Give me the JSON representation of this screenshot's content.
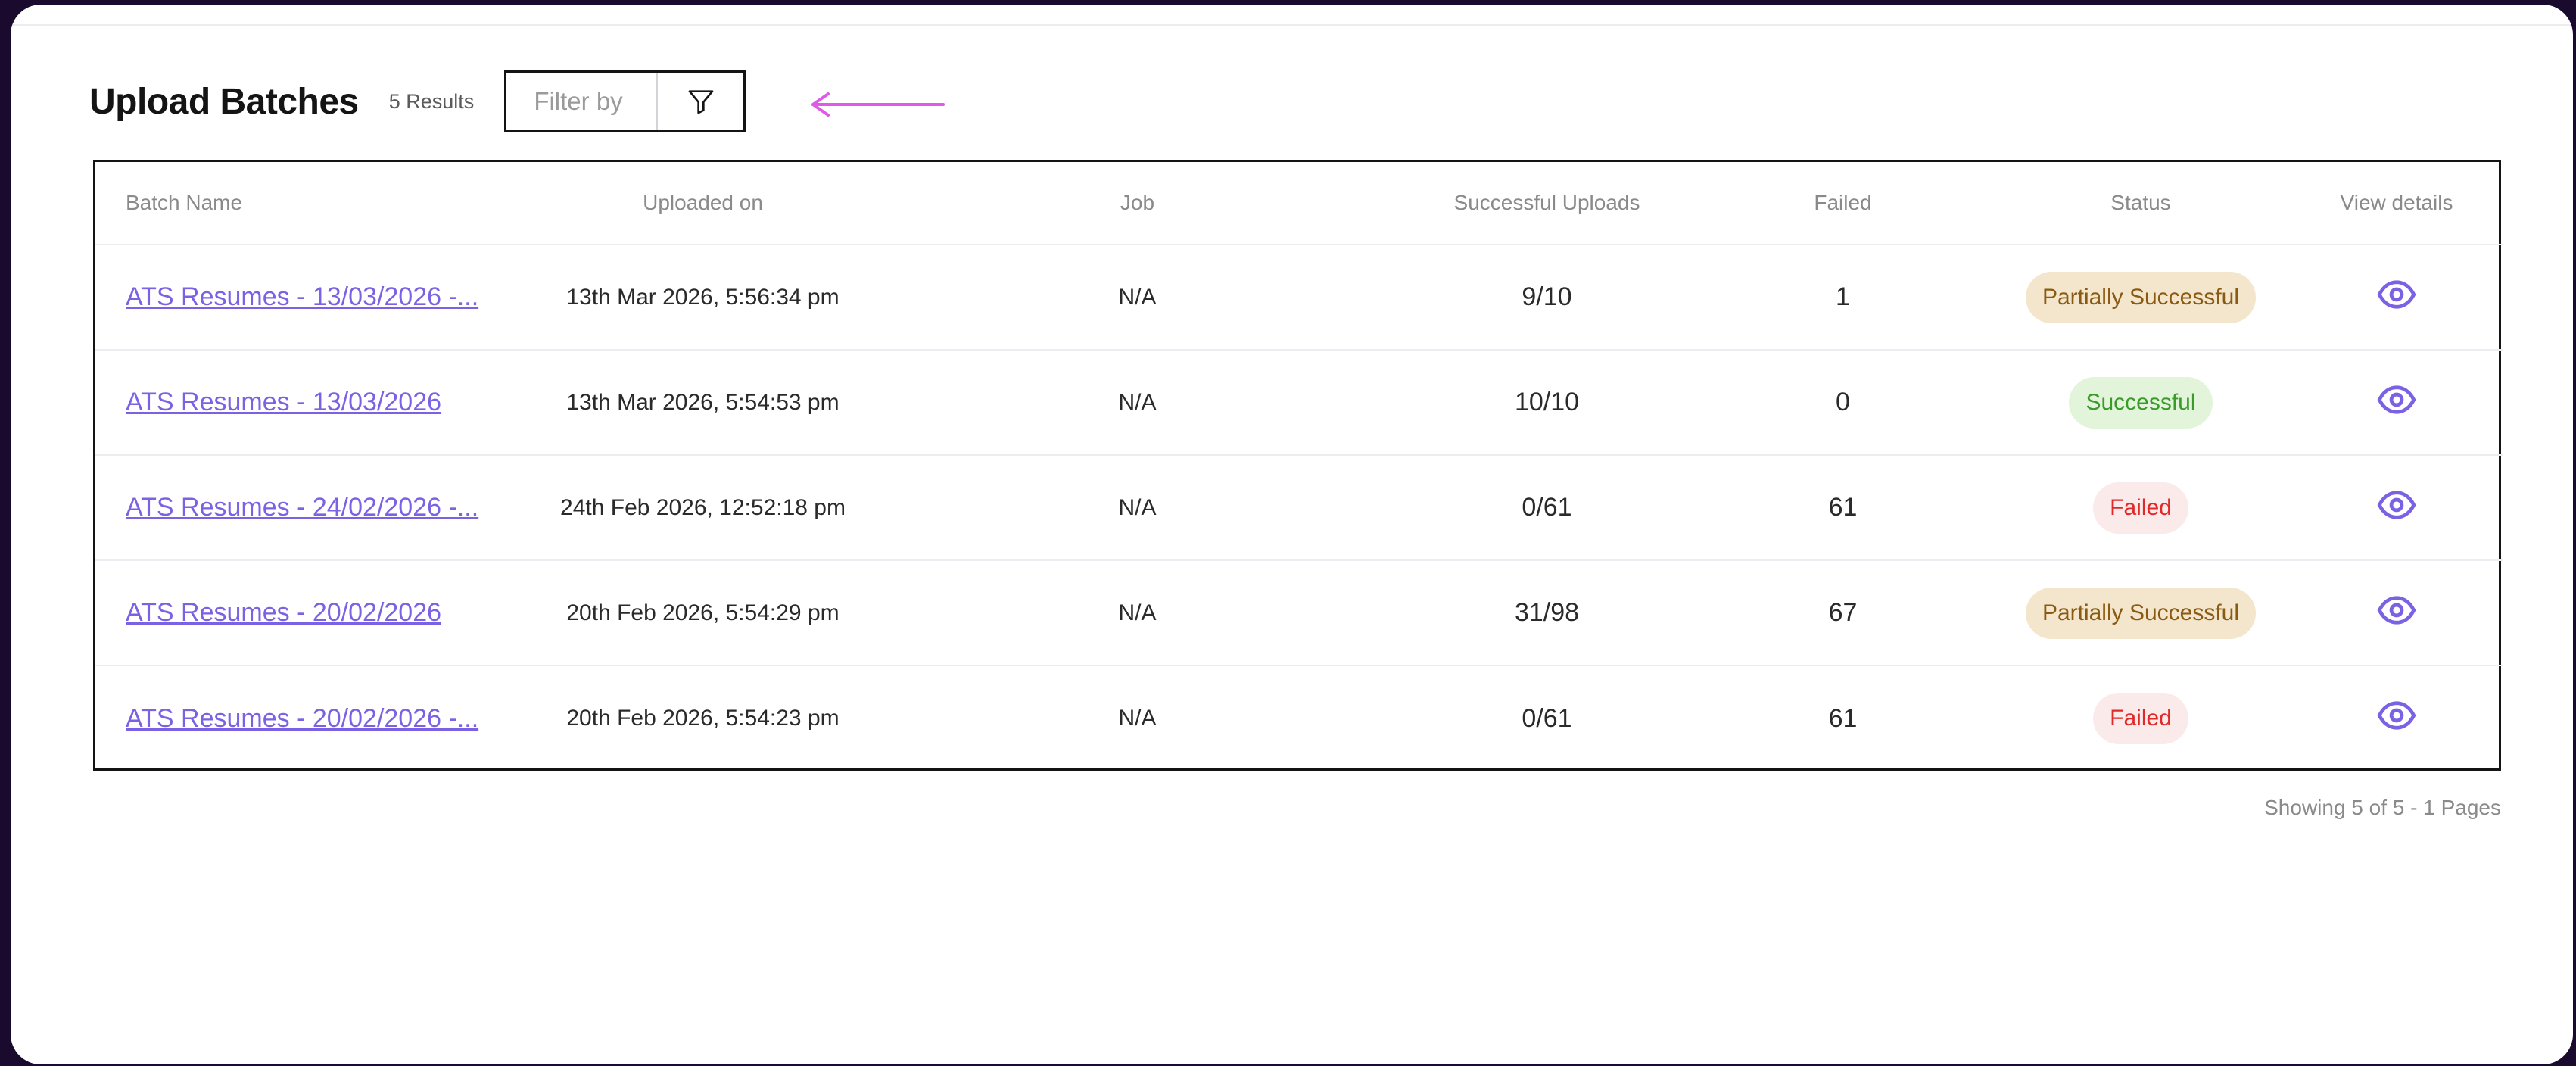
{
  "header": {
    "title": "Upload Batches",
    "results_count": "5 Results",
    "filter_placeholder": "Filter by"
  },
  "colors": {
    "accent": "#7b61e3",
    "annotation_arrow": "#e05ae8",
    "partial_bg": "#f3e6cc",
    "success_bg": "#e2f4da",
    "failed_bg": "#fbeaea"
  },
  "table": {
    "columns": [
      "Batch Name",
      "Uploaded on",
      "Job",
      "Successful Uploads",
      "Failed",
      "Status",
      "View details"
    ],
    "rows": [
      {
        "batch_name": "ATS Resumes - 13/03/2026 -...",
        "uploaded_on": "13th Mar 2026, 5:56:34 pm",
        "job": "N/A",
        "successful_uploads": "9/10",
        "failed": "1",
        "status": "Partially Successful",
        "status_type": "partial",
        "view_icon": "eye-icon"
      },
      {
        "batch_name": "ATS Resumes - 13/03/2026",
        "uploaded_on": "13th Mar 2026, 5:54:53 pm",
        "job": "N/A",
        "successful_uploads": "10/10",
        "failed": "0",
        "status": "Successful",
        "status_type": "success",
        "view_icon": "eye-icon"
      },
      {
        "batch_name": "ATS Resumes - 24/02/2026 -...",
        "uploaded_on": "24th Feb 2026, 12:52:18 pm",
        "job": "N/A",
        "successful_uploads": "0/61",
        "failed": "61",
        "status": "Failed",
        "status_type": "failed",
        "view_icon": "eye-icon"
      },
      {
        "batch_name": "ATS Resumes - 20/02/2026",
        "uploaded_on": "20th Feb 2026, 5:54:29 pm",
        "job": "N/A",
        "successful_uploads": "31/98",
        "failed": "67",
        "status": "Partially Successful",
        "status_type": "partial",
        "view_icon": "eye-icon"
      },
      {
        "batch_name": "ATS Resumes - 20/02/2026 -...",
        "uploaded_on": "20th Feb 2026, 5:54:23 pm",
        "job": "N/A",
        "successful_uploads": "0/61",
        "failed": "61",
        "status": "Failed",
        "status_type": "failed",
        "view_icon": "eye-icon"
      }
    ]
  },
  "pagination": {
    "summary": "Showing 5 of 5 - 1 Pages"
  }
}
